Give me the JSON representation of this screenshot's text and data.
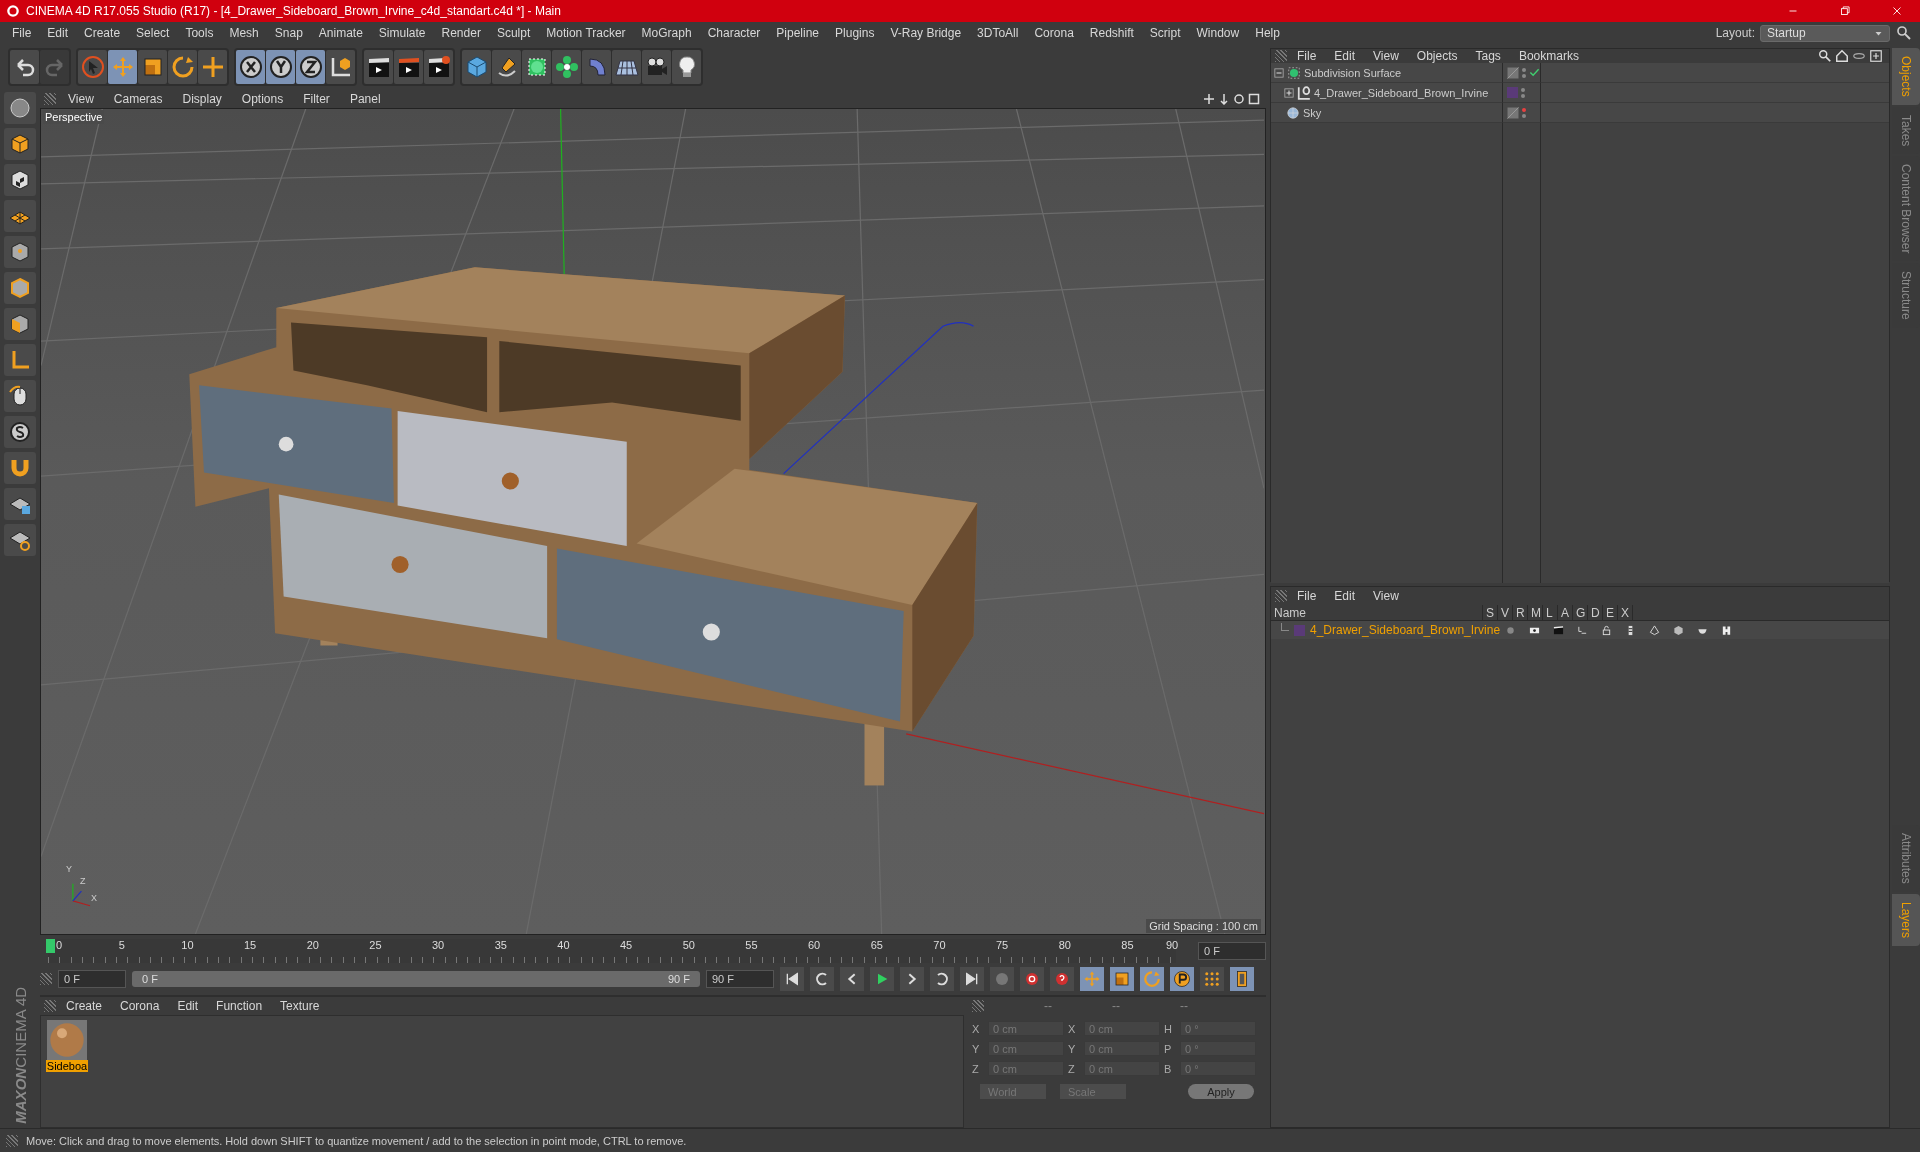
{
  "window": {
    "title": "CINEMA 4D R17.055 Studio (R17) - [4_Drawer_Sideboard_Brown_Irvine_c4d_standart.c4d *] - Main"
  },
  "menu": [
    "File",
    "Edit",
    "Create",
    "Select",
    "Tools",
    "Mesh",
    "Snap",
    "Animate",
    "Simulate",
    "Render",
    "Sculpt",
    "Motion Tracker",
    "MoGraph",
    "Character",
    "Pipeline",
    "Plugins",
    "V-Ray Bridge",
    "3DToAll",
    "Corona",
    "Redshift",
    "Script",
    "Window",
    "Help"
  ],
  "layout": {
    "label": "Layout:",
    "value": "Startup"
  },
  "toolbar_groups": [
    {
      "items": [
        {
          "kind": "undo",
          "selected": false,
          "disabled": false
        },
        {
          "kind": "redo",
          "selected": false,
          "disabled": true
        }
      ]
    },
    {
      "items": [
        {
          "kind": "select",
          "selected": false,
          "disabled": false
        },
        {
          "kind": "move",
          "selected": true,
          "disabled": false
        },
        {
          "kind": "scale",
          "selected": false,
          "disabled": false
        },
        {
          "kind": "rotate",
          "selected": false,
          "disabled": false
        },
        {
          "kind": "transform",
          "selected": false,
          "disabled": false
        }
      ]
    },
    {
      "items": [
        {
          "kind": "axis-x",
          "selected": true,
          "disabled": false
        },
        {
          "kind": "axis-y",
          "selected": true,
          "disabled": false
        },
        {
          "kind": "axis-z",
          "selected": true,
          "disabled": false
        },
        {
          "kind": "coords",
          "selected": false,
          "disabled": false
        }
      ]
    },
    {
      "items": [
        {
          "kind": "render-view",
          "selected": false,
          "disabled": false
        },
        {
          "kind": "render",
          "selected": false,
          "disabled": false
        },
        {
          "kind": "render-settings",
          "selected": false,
          "disabled": false
        }
      ]
    },
    {
      "items": [
        {
          "kind": "cube",
          "selected": false,
          "disabled": false
        },
        {
          "kind": "pen",
          "selected": false,
          "disabled": false
        },
        {
          "kind": "subdivision",
          "selected": false,
          "disabled": false
        },
        {
          "kind": "cloner",
          "selected": false,
          "disabled": false
        },
        {
          "kind": "deformer",
          "selected": false,
          "disabled": false
        },
        {
          "kind": "floor",
          "selected": false,
          "disabled": false
        },
        {
          "kind": "camera",
          "selected": false,
          "disabled": false
        },
        {
          "kind": "light",
          "selected": false,
          "disabled": false
        }
      ]
    }
  ],
  "viewport": {
    "menu": [
      "View",
      "Cameras",
      "Display",
      "Options",
      "Filter",
      "Panel"
    ],
    "camera": "Perspective",
    "grid_spacing": "Grid Spacing : 100 cm",
    "axis_labels": [
      "Y",
      "Z",
      "X"
    ]
  },
  "timeline": {
    "ticks": [
      "0",
      "5",
      "10",
      "15",
      "20",
      "25",
      "30",
      "35",
      "40",
      "45",
      "50",
      "55",
      "60",
      "65",
      "70",
      "75",
      "80",
      "85",
      "90"
    ],
    "playhead": {
      "level": 0
    },
    "current_frame": "0 F",
    "start_field": "0 F",
    "range_start": "0 F",
    "range": {
      "level": 1
    },
    "range_end": "90 F",
    "end_field": "90 F",
    "key_buttons": [
      {
        "kind": "move",
        "selected": true
      },
      {
        "kind": "scale",
        "selected": true
      },
      {
        "kind": "rotate",
        "selected": true
      },
      {
        "kind": "param",
        "selected": true
      },
      {
        "kind": "dots",
        "selected": false
      },
      {
        "kind": "film",
        "selected": true
      }
    ]
  },
  "materials": {
    "menu": [
      "Create",
      "Corona",
      "Edit",
      "Function",
      "Texture"
    ],
    "items": [
      {
        "name": "Sideboa",
        "selected": true
      }
    ]
  },
  "coordinates": {
    "headers": [
      "--",
      "--",
      "--"
    ],
    "rows": [
      {
        "pos_label": "X",
        "pos": "0 cm",
        "size_label": "X",
        "size": "0 cm",
        "rot_label": "H",
        "rot": "0 °"
      },
      {
        "pos_label": "Y",
        "pos": "0 cm",
        "size_label": "Y",
        "size": "0 cm",
        "rot_label": "P",
        "rot": "0 °"
      },
      {
        "pos_label": "Z",
        "pos": "0 cm",
        "size_label": "Z",
        "size": "0 cm",
        "rot_label": "B",
        "rot": "0 °"
      }
    ],
    "mode": "World",
    "size_mode": "Scale",
    "apply": "Apply"
  },
  "logo": {
    "brand": "MAXON",
    "product": "CINEMA 4D"
  },
  "objects": {
    "menu": [
      "File",
      "Edit",
      "View",
      "Objects",
      "Tags",
      "Bookmarks"
    ],
    "tree": [
      {
        "name": "Subdivision Surface",
        "kind": "subdivision",
        "expanded": true,
        "enabled": true,
        "editor_hidden": false,
        "children": [
          {
            "name": "4_Drawer_Sideboard_Brown_Irvine",
            "kind": "null",
            "expanded": false,
            "color": "#5a3a78",
            "editor_hidden": false
          }
        ]
      },
      {
        "name": "Sky",
        "kind": "sky",
        "editor_hidden": true
      }
    ]
  },
  "layers": {
    "menu": [
      "File",
      "Edit",
      "View"
    ],
    "columns": [
      "Name",
      "S",
      "V",
      "R",
      "M",
      "L",
      "A",
      "G",
      "D",
      "E",
      "X"
    ],
    "rows": [
      {
        "name": "4_Drawer_Sideboard_Brown_Irvine",
        "color": "#5a3a78"
      }
    ]
  },
  "side_tabs_top": [
    {
      "label": "Objects",
      "selected": true
    },
    {
      "label": "Takes",
      "selected": false
    },
    {
      "label": "Content Browser",
      "selected": false
    },
    {
      "label": "Structure",
      "selected": false
    }
  ],
  "side_tabs_bottom": [
    {
      "label": "Attributes",
      "selected": false
    },
    {
      "label": "Layers",
      "selected": true
    }
  ],
  "status_bar": "Move: Click and drag to move elements. Hold down SHIFT to quantize movement / add to the selection in point mode, CTRL to remove."
}
